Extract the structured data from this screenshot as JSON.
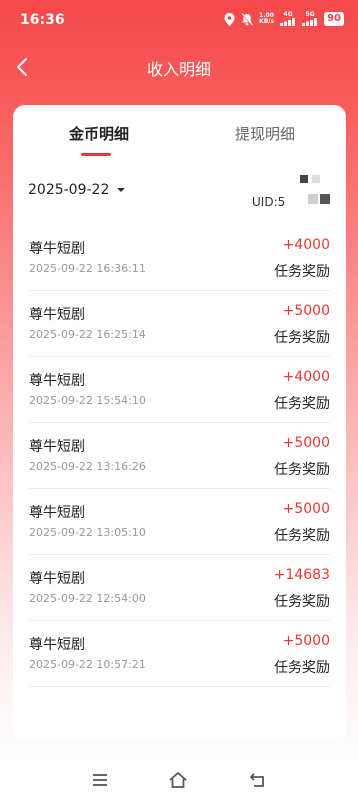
{
  "status_bar": {
    "time": "16:36",
    "speed_value": "1.00",
    "speed_unit": "KB/s",
    "net1": "4G",
    "net2": "5G",
    "battery": "90"
  },
  "header": {
    "title": "收入明细"
  },
  "tabs": [
    {
      "label": "金币明细",
      "active": true
    },
    {
      "label": "提现明细",
      "active": false
    }
  ],
  "filter": {
    "date": "2025-09-22",
    "uid_top": "",
    "uid_label": "UID:5"
  },
  "records": [
    {
      "title": "尊牛短剧",
      "time": "2025-09-22 16:36:11",
      "amount": "+4000",
      "type": "任务奖励"
    },
    {
      "title": "尊牛短剧",
      "time": "2025-09-22 16:25:14",
      "amount": "+5000",
      "type": "任务奖励"
    },
    {
      "title": "尊牛短剧",
      "time": "2025-09-22 15:54:10",
      "amount": "+4000",
      "type": "任务奖励"
    },
    {
      "title": "尊牛短剧",
      "time": "2025-09-22 13:16:26",
      "amount": "+5000",
      "type": "任务奖励"
    },
    {
      "title": "尊牛短剧",
      "time": "2025-09-22 13:05:10",
      "amount": "+5000",
      "type": "任务奖励"
    },
    {
      "title": "尊牛短剧",
      "time": "2025-09-22 12:54:00",
      "amount": "+14683",
      "type": "任务奖励"
    },
    {
      "title": "尊牛短剧",
      "time": "2025-09-22 10:57:21",
      "amount": "+5000",
      "type": "任务奖励"
    }
  ],
  "colors": {
    "accent": "#e53935",
    "header_bg": "#f5484a"
  },
  "icons": {
    "back": "chevron-left-icon",
    "location": "location-icon",
    "mute": "bell-off-icon",
    "menu": "menu-icon",
    "home": "home-icon",
    "return": "return-icon"
  }
}
